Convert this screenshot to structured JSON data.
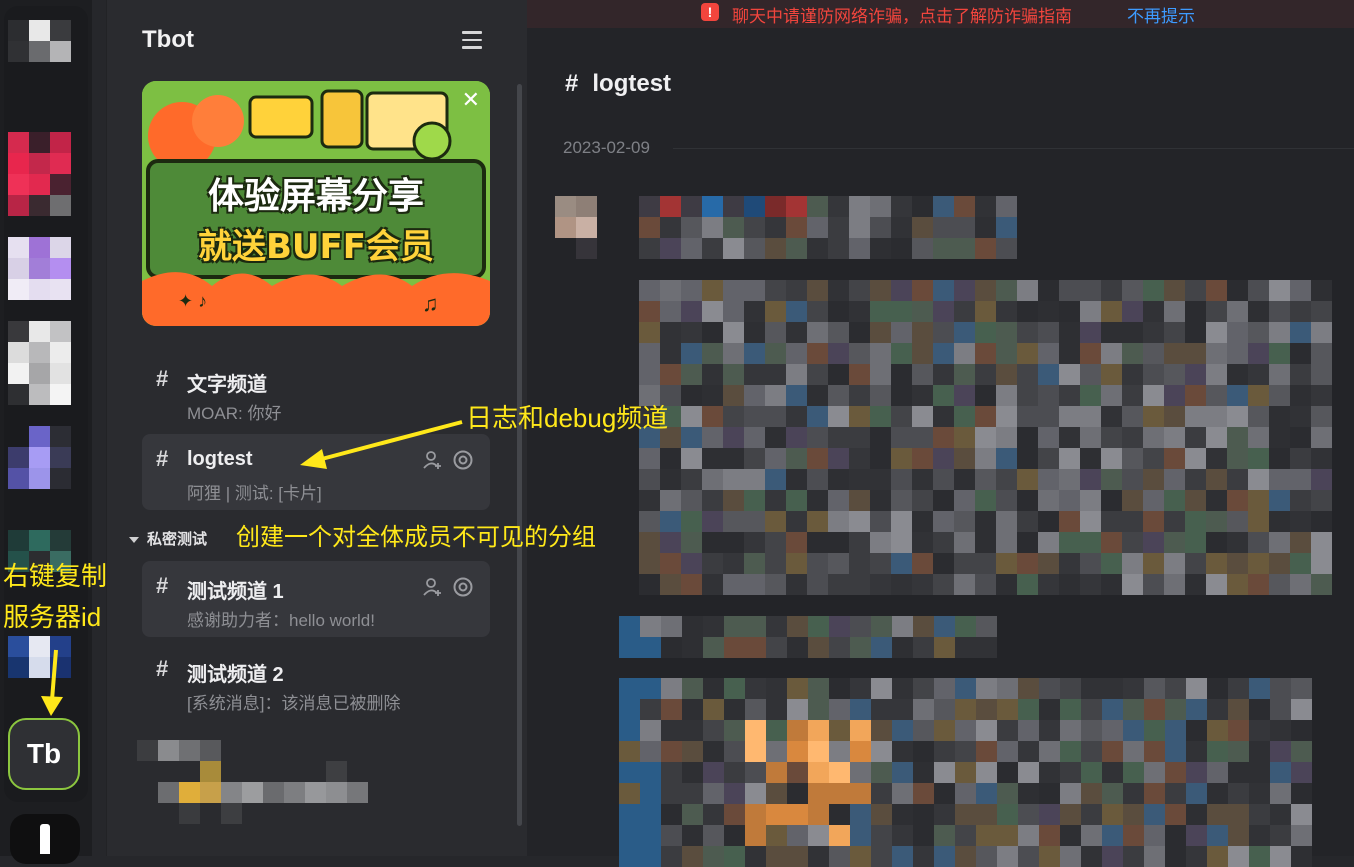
{
  "server_list": {
    "active_server_initials": "Tb"
  },
  "sidebar": {
    "server_name": "Tbot",
    "banner": {
      "line1": "体验屏幕分享",
      "line2": "就送BUFF会员"
    },
    "channels": [
      {
        "name": "文字频道",
        "preview": "MOAR: 你好",
        "icon": "hash-icon",
        "active": false
      },
      {
        "name": "logtest",
        "preview": "阿狸 | 测试: [卡片]",
        "icon": "hash-icon",
        "active": true
      },
      {
        "name": "测试频道 1",
        "preview": "感谢助力者：hello world!",
        "icon": "private-hash-icon",
        "active": true
      },
      {
        "name": "测试频道 2",
        "preview": "[系统消息]：该消息已被删除",
        "icon": "private-hash-icon",
        "active": false
      }
    ],
    "group_label": "私密测试"
  },
  "main": {
    "notice_text": "聊天中请谨防网络诈骗，点击了解防诈骗指南",
    "notice_dismiss": "不再提示",
    "channel_title": "logtest",
    "date_separator": "2023-02-09"
  },
  "annotations": {
    "logtest_note": "日志和debug频道",
    "group_note": "创建一个对全体成员不可见的分组",
    "copy_id_line1": "右键复制",
    "copy_id_line2": "服务器id"
  },
  "colors": {
    "annotation": "#ffe81a",
    "accent_green": "#8cc63f",
    "notice_red": "#f2453d",
    "link_blue": "#3d9bff"
  }
}
